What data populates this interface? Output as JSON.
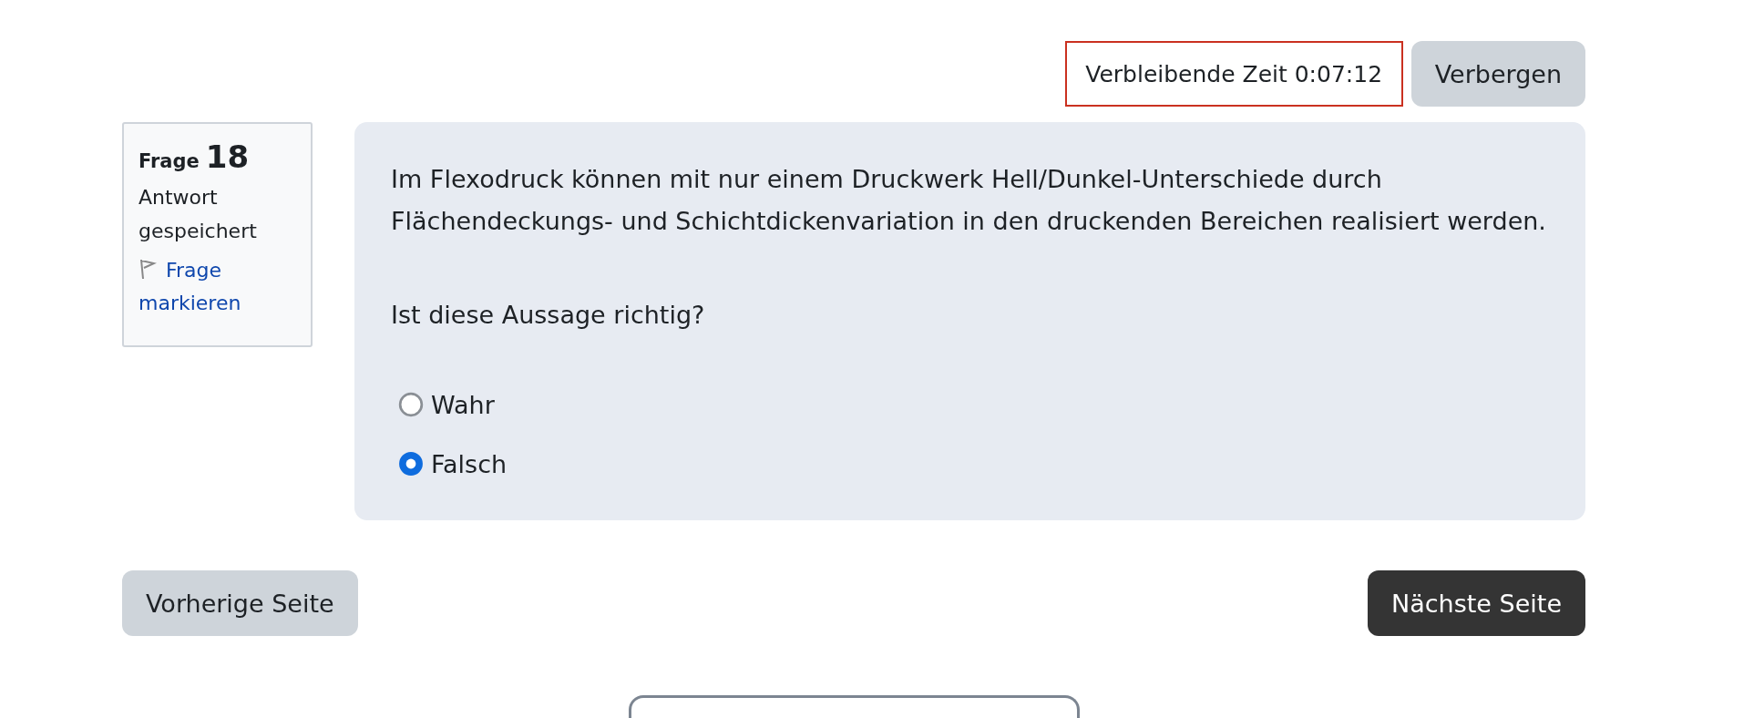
{
  "timer": {
    "label": "Verbleibende Zeit 0:07:12",
    "hide_button": "Verbergen"
  },
  "question_info": {
    "label": "Frage",
    "number": "18",
    "status": "Antwort gespeichert",
    "flag_link": "Frage markieren"
  },
  "question": {
    "text": "Im Flexodruck können mit nur einem Druckwerk Hell/Dunkel-Unterschiede durch Flächendeckungs- und Schichtdickenvariation in den druckenden Bereichen realisiert werden.",
    "prompt": "Ist diese Aussage richtig?",
    "options": [
      {
        "label": "Wahr",
        "selected": false
      },
      {
        "label": "Falsch",
        "selected": true
      }
    ]
  },
  "navigation": {
    "previous": "Vorherige Seite",
    "next": "Nächste Seite"
  }
}
